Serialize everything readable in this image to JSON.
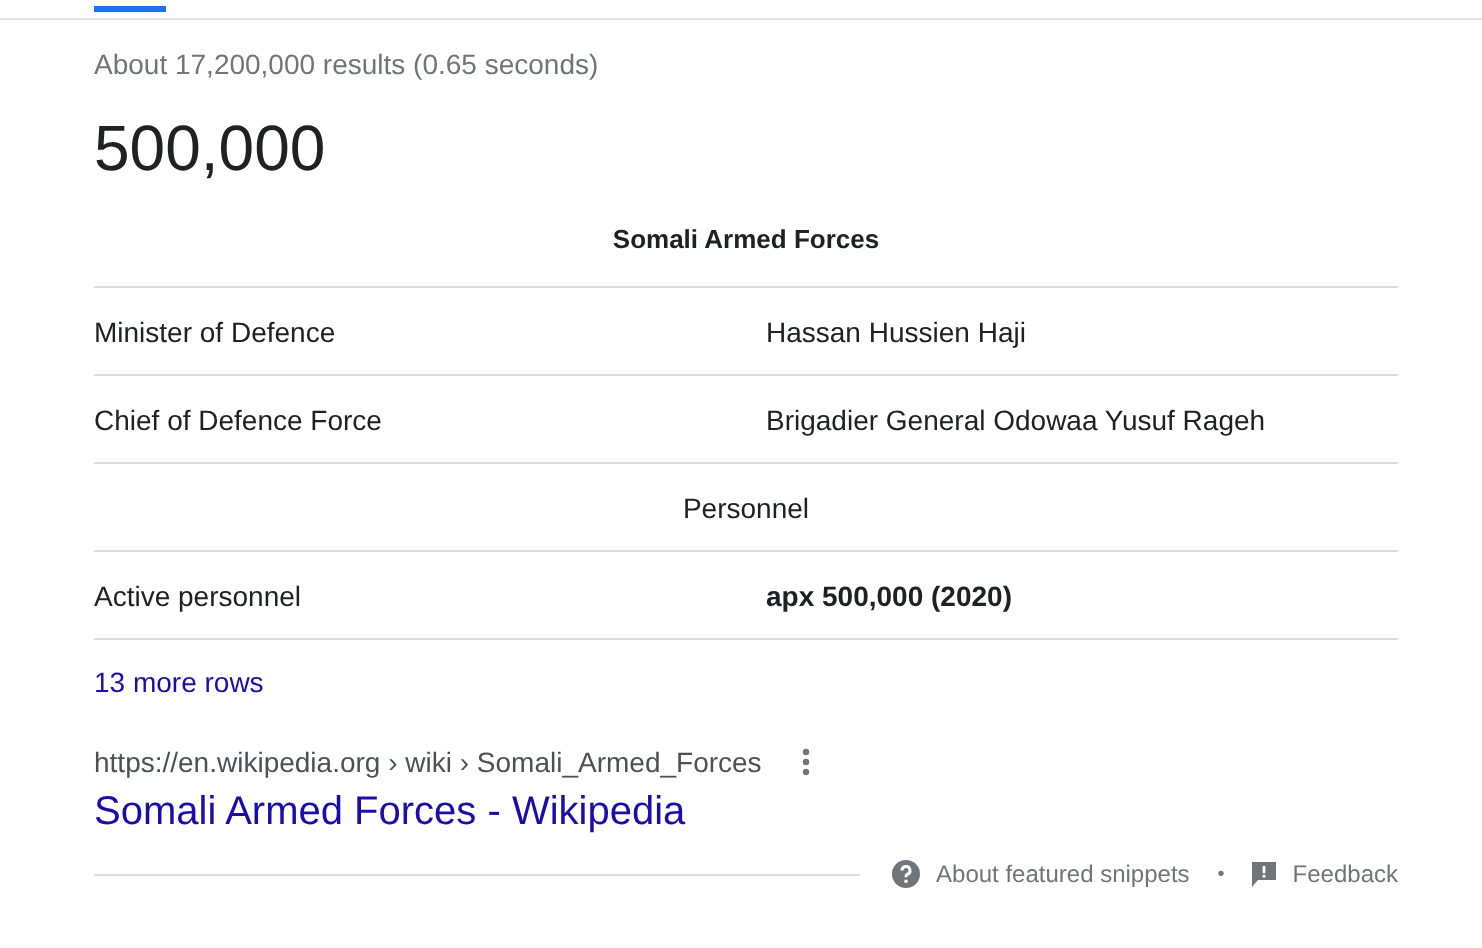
{
  "result_stats": "About 17,200,000 results (0.65 seconds)",
  "answer": "500,000",
  "table": {
    "title": "Somali Armed Forces",
    "rows": [
      {
        "kind": "pair",
        "label": "Minister of Defence",
        "value": "Hassan Hussien Haji",
        "value_bold": false
      },
      {
        "kind": "pair",
        "label": "Chief of Defence Force",
        "value": "Brigadier General Odowaa Yusuf Rageh",
        "value_bold": false
      },
      {
        "kind": "section",
        "label": "Personnel"
      },
      {
        "kind": "pair",
        "label": "Active personnel",
        "value": "apx 500,000 (2020)",
        "value_bold": true
      }
    ]
  },
  "more_rows": "13 more rows",
  "source": {
    "domain": "https://en.wikipedia.org",
    "path": [
      "wiki",
      "Somali_Armed_Forces"
    ],
    "separator": "›",
    "title": "Somali Armed Forces - Wikipedia"
  },
  "footer": {
    "about": "About featured snippets",
    "separator": "•",
    "feedback": "Feedback"
  }
}
